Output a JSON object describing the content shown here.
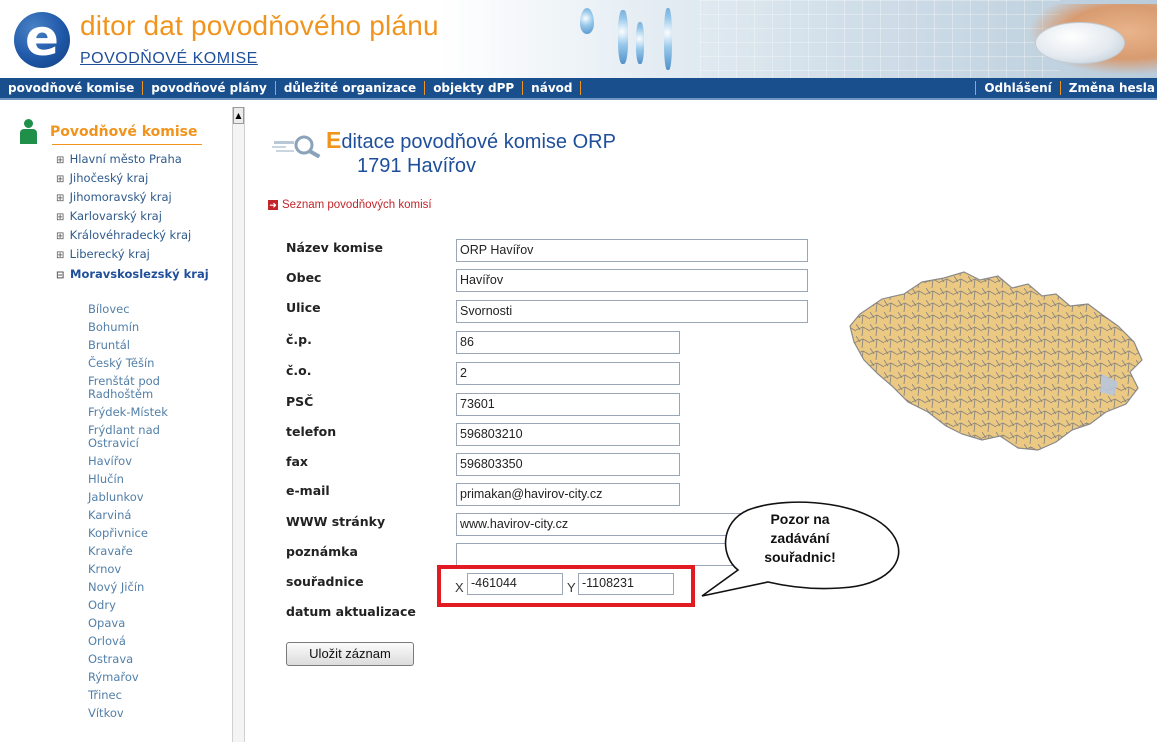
{
  "header": {
    "logo_letter": "e",
    "title": "ditor dat povodňového plánu",
    "subtitle": "POVODŇOVÉ KOMISE"
  },
  "nav": {
    "items": [
      "povodňové komise",
      "povodňové plány",
      "důležité organizace",
      "objekty dPP",
      "návod"
    ],
    "right_items": [
      "Odhlášení",
      "Změna hesla"
    ]
  },
  "sidebar": {
    "title": "Povodňové komise",
    "regions": [
      {
        "toggle": "⊞",
        "label": "Hlavní město Praha"
      },
      {
        "toggle": "⊞",
        "label": "Jihočeský kraj"
      },
      {
        "toggle": "⊞",
        "label": "Jihomoravský kraj"
      },
      {
        "toggle": "⊞",
        "label": "Karlovarský kraj"
      },
      {
        "toggle": "⊞",
        "label": "Královéhradecký kraj"
      },
      {
        "toggle": "⊞",
        "label": "Liberecký kraj"
      },
      {
        "toggle": "⊟",
        "label": "Moravskoslezský kraj"
      }
    ],
    "towns": [
      "Bílovec",
      "Bohumín",
      "Bruntál",
      "Český Těšín",
      "Frenštát pod Radhoštěm",
      "Frýdek-Místek",
      "Frýdlant nad Ostravicí",
      "Havířov",
      "Hlučín",
      "Jablunkov",
      "Karviná",
      "Kopřivnice",
      "Kravaře",
      "Krnov",
      "Nový Jičín",
      "Odry",
      "Opava",
      "Orlová",
      "Ostrava",
      "Rýmařov",
      "Třinec",
      "Vítkov"
    ]
  },
  "main": {
    "title_first_letter": "E",
    "title_rest": "ditace povodňové komise ORP",
    "title_line2": "1791 Havířov",
    "back_link": "Seznam povodňových komisí",
    "labels": {
      "nazev": "Název komise",
      "obec": "Obec",
      "ulice": "Ulice",
      "cp": "č.p.",
      "co": "č.o.",
      "psc": "PSČ",
      "telefon": "telefon",
      "fax": "fax",
      "email": "e-mail",
      "www": "WWW stránky",
      "poznamka": "poznámka",
      "souradnice": "souřadnice",
      "datum": "datum aktualizace"
    },
    "values": {
      "nazev": "ORP Havířov",
      "obec": "Havířov",
      "ulice": "Svornosti",
      "cp": "86",
      "co": "2",
      "psc": "73601",
      "telefon": "596803210",
      "fax": "596803350",
      "email": "primakan@havirov-city.cz",
      "www": "www.havirov-city.cz",
      "poznamka": ""
    },
    "coords": {
      "x_label": "X",
      "x_value": "-461044",
      "y_label": "Y",
      "y_value": "-1108231"
    },
    "save_label": "Uložit záznam"
  },
  "callout": {
    "line1": "Pozor na",
    "line2": "zadávání",
    "line3": "souřadnic!"
  },
  "colors": {
    "accent": "#f1941d",
    "brand": "#1f4f9a",
    "highlight": "#e21b23"
  }
}
